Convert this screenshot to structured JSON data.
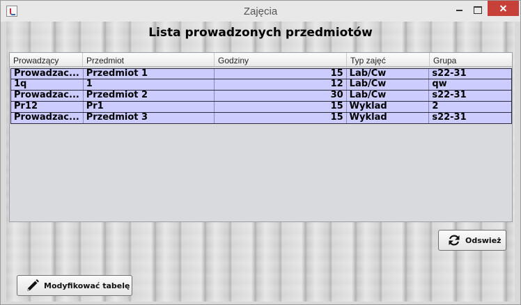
{
  "window": {
    "title": "Zajęcia"
  },
  "heading": "Lista prowadzonych przedmiotów",
  "table": {
    "columns": [
      "Prowadzący",
      "Przedmiot",
      "Godziny",
      "Typ zajęć",
      "Grupa"
    ],
    "rows": [
      [
        "Prowadzac...",
        "Przedmiot 1",
        "15",
        "Lab/Cw",
        "s22-31"
      ],
      [
        "1q",
        "1",
        "12",
        "Lab/Cw",
        "qw"
      ],
      [
        "Prowadzac...",
        "Przedmiot 2",
        "30",
        "Lab/Cw",
        "s22-31"
      ],
      [
        "Pr12",
        "Pr1",
        "15",
        "Wyklad",
        "2"
      ],
      [
        "Prowadzac...",
        "Przedmiot 3",
        "15",
        "Wyklad",
        "s22-31"
      ]
    ]
  },
  "buttons": {
    "refresh_label": "Odswież",
    "modify_label": "Modyfikować tabelę"
  },
  "icons": {
    "refresh": "refresh-icon",
    "modify": "pencil-icon"
  },
  "colors": {
    "row_selected": "#ccccff",
    "close_button": "#c7413a"
  }
}
